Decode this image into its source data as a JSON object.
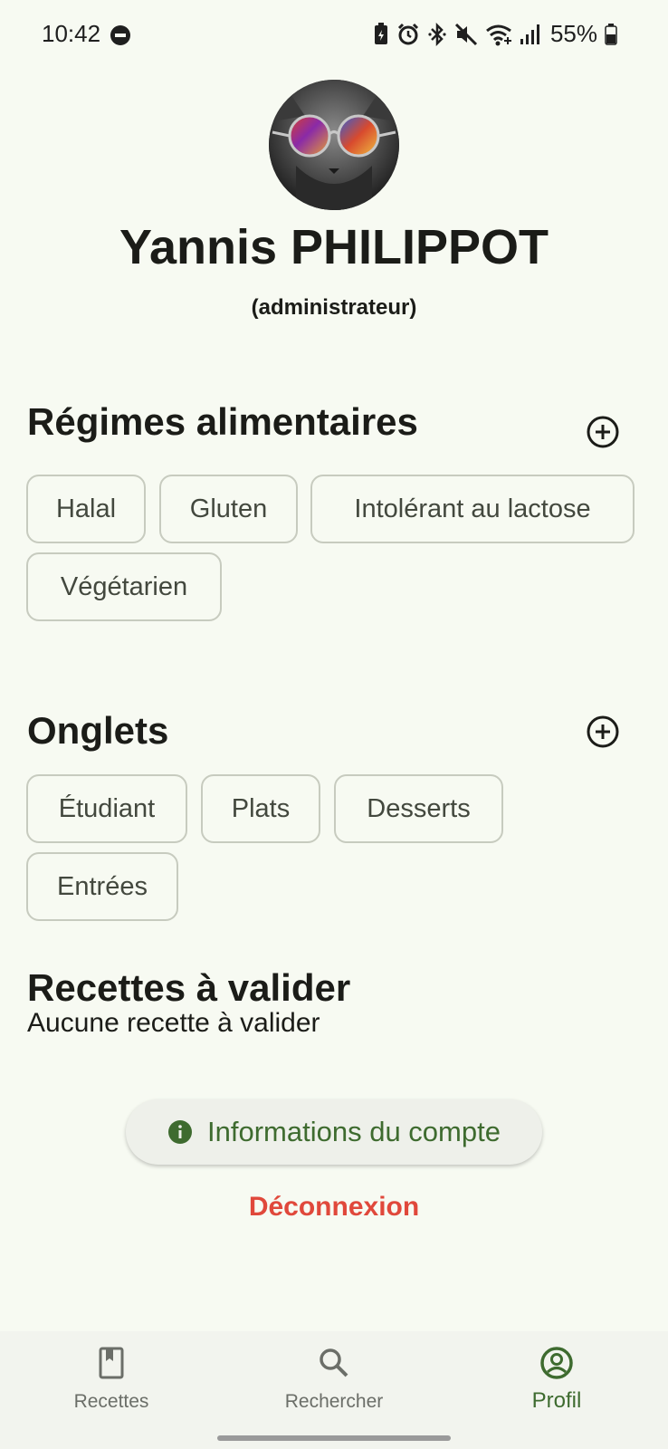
{
  "status_bar": {
    "time": "10:42",
    "battery": "55%",
    "icons": [
      "do-not-disturb-icon",
      "battery-saver-icon",
      "alarm-icon",
      "bluetooth-icon",
      "mute-icon",
      "wifi-icon",
      "signal-icon",
      "battery-icon"
    ]
  },
  "profile": {
    "name": "Yannis PHILIPPOT",
    "role": "(administrateur)"
  },
  "diets": {
    "title": "Régimes alimentaires",
    "items": [
      "Halal",
      "Gluten",
      "Intolérant au lactose",
      "Végétarien"
    ]
  },
  "tabs_section": {
    "title": "Onglets",
    "items": [
      "Étudiant",
      "Plats",
      "Desserts",
      "Entrées"
    ]
  },
  "pending": {
    "title": "Recettes à valider",
    "empty": "Aucune recette à valider"
  },
  "actions": {
    "account_info": "Informations du compte",
    "logout": "Déconnexion"
  },
  "nav": {
    "items": [
      {
        "label": "Recettes",
        "icon": "book-icon"
      },
      {
        "label": "Rechercher",
        "icon": "search-icon"
      },
      {
        "label": "Profil",
        "icon": "account-circle-icon",
        "active": true
      }
    ]
  },
  "colors": {
    "primary": "#3e6b2f",
    "danger": "#e0483b",
    "background": "#f7faf2"
  }
}
